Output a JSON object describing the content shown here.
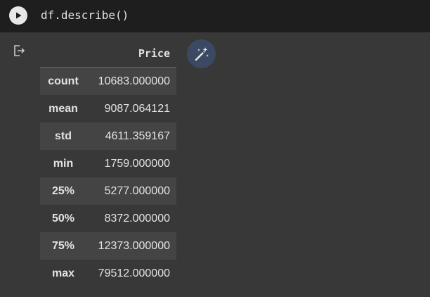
{
  "cell": {
    "code": "df.describe()",
    "run_icon": "play-icon"
  },
  "output": {
    "output_icon": "output-redirect-icon",
    "magic_icon": "magic-wand-icon",
    "table": {
      "column_header": "Price",
      "rows": [
        {
          "label": "count",
          "value": "10683.000000"
        },
        {
          "label": "mean",
          "value": "9087.064121"
        },
        {
          "label": "std",
          "value": "4611.359167"
        },
        {
          "label": "min",
          "value": "1759.000000"
        },
        {
          "label": "25%",
          "value": "5277.000000"
        },
        {
          "label": "50%",
          "value": "8372.000000"
        },
        {
          "label": "75%",
          "value": "12373.000000"
        },
        {
          "label": "max",
          "value": "79512.000000"
        }
      ]
    }
  },
  "colors": {
    "cell_background": "#1e1e1e",
    "output_background": "#383838",
    "row_stripe": "#444444",
    "magic_button": "#3b4a62"
  }
}
